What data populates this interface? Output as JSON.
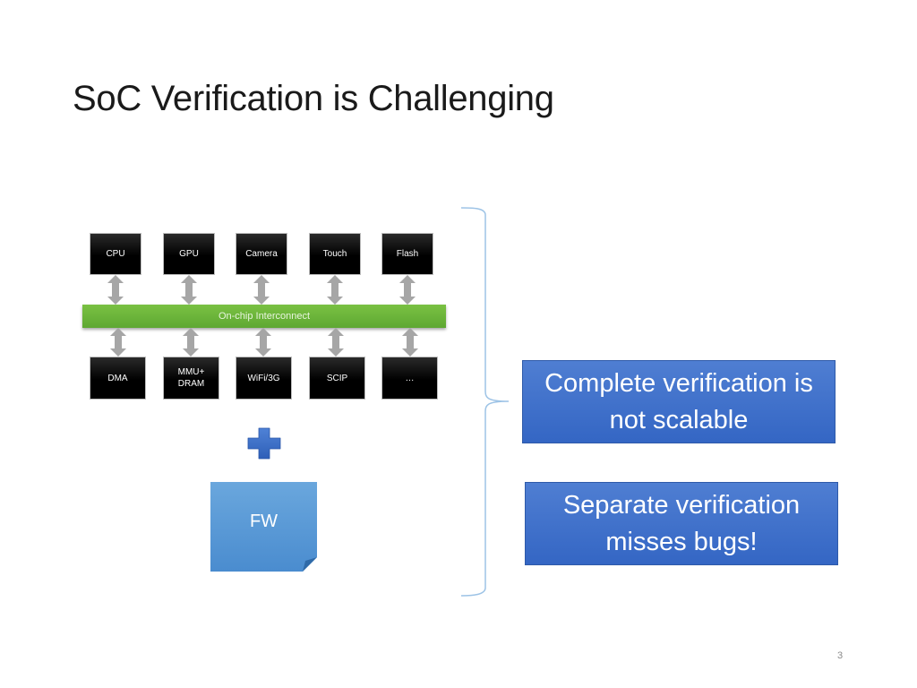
{
  "slide": {
    "title": "SoC Verification is Challenging",
    "page_number": "3"
  },
  "diagram": {
    "top_components": [
      "CPU",
      "GPU",
      "Camera",
      "Touch",
      "Flash"
    ],
    "interconnect_label": "On-chip Interconnect",
    "bottom_components": [
      "DMA",
      "MMU+\nDRAM",
      "WiFi/3G",
      "SCIP",
      "…"
    ],
    "plus_icon": "plus-icon",
    "firmware_label": "FW",
    "colors": {
      "component_fill": "#000000",
      "interconnect_fill": "#6cb53a",
      "arrow_fill": "#a6a6a6",
      "firmware_fill": "#5b9bd5",
      "plus_fill": "#3b6fc7",
      "callout_fill": "#4472c4",
      "brace_stroke": "#9dc3e6"
    }
  },
  "callouts": [
    "Complete verification is not scalable",
    "Separate verification misses bugs!"
  ]
}
